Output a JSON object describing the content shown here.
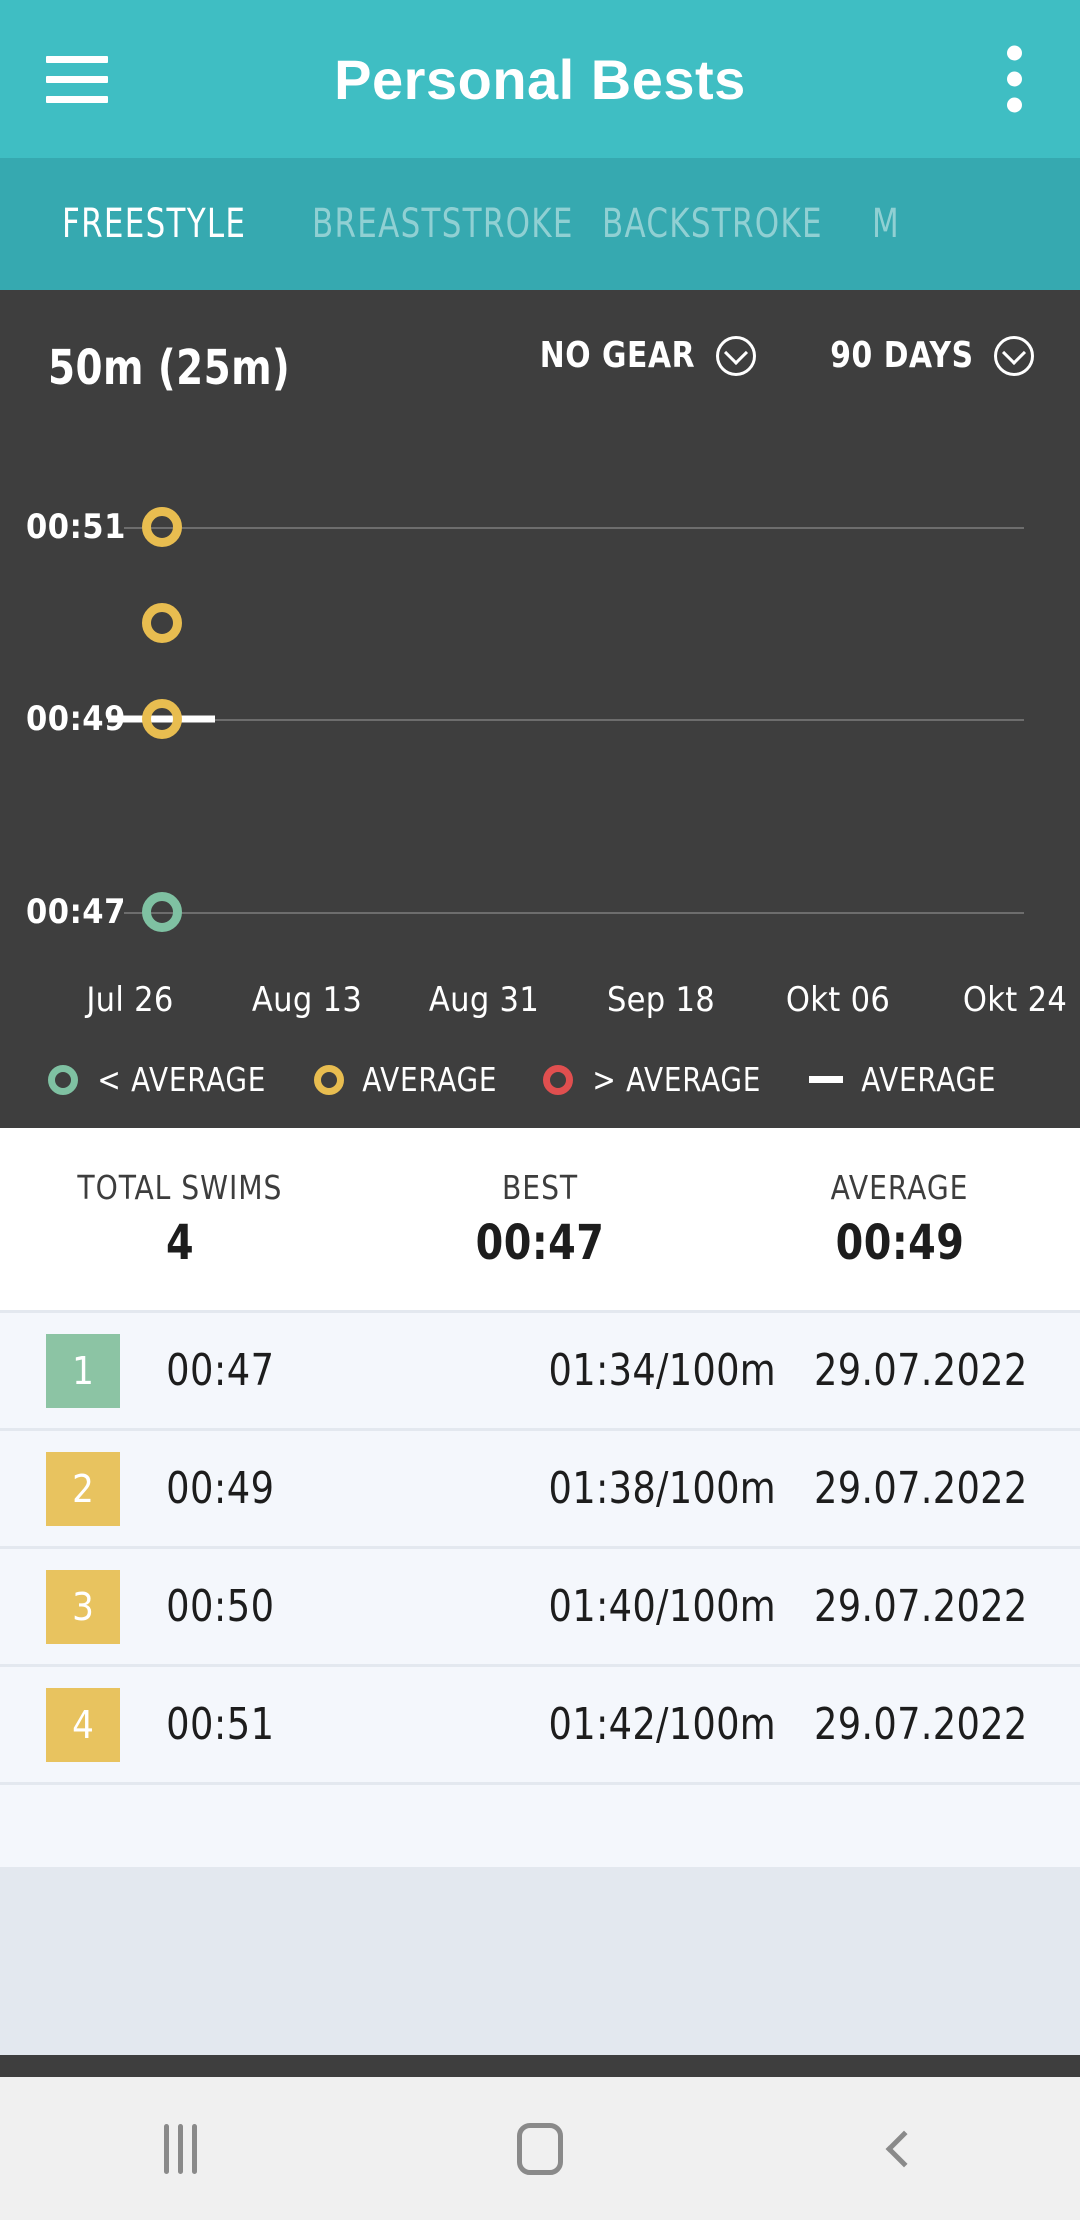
{
  "appbar": {
    "title": "Personal Bests",
    "menu_icon": "hamburger-icon",
    "overflow_icon": "more-vertical-icon",
    "background": "#3fbec3"
  },
  "tabs": [
    {
      "label": "FREESTYLE",
      "active": true
    },
    {
      "label": "BREASTSTROKE",
      "active": false
    },
    {
      "label": "BACKSTROKE",
      "active": false
    },
    {
      "label": "M",
      "active": false
    }
  ],
  "chart_header": {
    "title": "50m (25m)",
    "gear_filter": "NO GEAR",
    "period_filter": "90 DAYS",
    "chevron_icon": "chevron-down-circle-icon"
  },
  "chart_data": {
    "type": "scatter",
    "title": "50m (25m)",
    "xlabel": "",
    "ylabel": "",
    "grid": true,
    "legend_position": "below",
    "y_ticks": [
      "00:51",
      "00:49",
      "00:47"
    ],
    "y_tick_values": [
      51,
      49,
      47
    ],
    "ylim": [
      46.5,
      51.8
    ],
    "x_ticks": [
      "Jul 26",
      "Aug 13",
      "Aug 31",
      "Sep 18",
      "Okt 06",
      "Okt 24"
    ],
    "average_value": 49,
    "average_line_label": "AVERAGE",
    "points": [
      {
        "x_label": "Jul 29",
        "value": 51,
        "display": "00:51",
        "category": "average",
        "color": "#e8bd50"
      },
      {
        "x_label": "Jul 29",
        "value": 50,
        "display": "00:50",
        "category": "average",
        "color": "#e8bd50"
      },
      {
        "x_label": "Jul 29",
        "value": 49,
        "display": "00:49",
        "category": "average",
        "color": "#e8bd50"
      },
      {
        "x_label": "Jul 29",
        "value": 47,
        "display": "00:47",
        "category": "below",
        "color": "#7fc1a2"
      }
    ],
    "legend": [
      {
        "marker": "ring",
        "color": "#7fc1a2",
        "label": "< AVERAGE"
      },
      {
        "marker": "ring",
        "color": "#e8bd50",
        "label": "AVERAGE"
      },
      {
        "marker": "ring",
        "color": "#e04f4f",
        "label": "> AVERAGE"
      },
      {
        "marker": "dash",
        "color": "#ffffff",
        "label": "AVERAGE"
      }
    ]
  },
  "summary": [
    {
      "label": "TOTAL SWIMS",
      "value": "4"
    },
    {
      "label": "BEST",
      "value": "00:47"
    },
    {
      "label": "AVERAGE",
      "value": "00:49"
    }
  ],
  "results": [
    {
      "rank": "1",
      "time": "00:47",
      "pace": "01:34/100m",
      "date": "29.07.2022",
      "badge_color": "green"
    },
    {
      "rank": "2",
      "time": "00:49",
      "pace": "01:38/100m",
      "date": "29.07.2022",
      "badge_color": "yellow"
    },
    {
      "rank": "3",
      "time": "00:50",
      "pace": "01:40/100m",
      "date": "29.07.2022",
      "badge_color": "yellow"
    },
    {
      "rank": "4",
      "time": "00:51",
      "pace": "01:42/100m",
      "date": "29.07.2022",
      "badge_color": "yellow"
    }
  ],
  "navbar": {
    "recents_icon": "recents-icon",
    "home_icon": "home-icon",
    "back_icon": "back-icon"
  }
}
